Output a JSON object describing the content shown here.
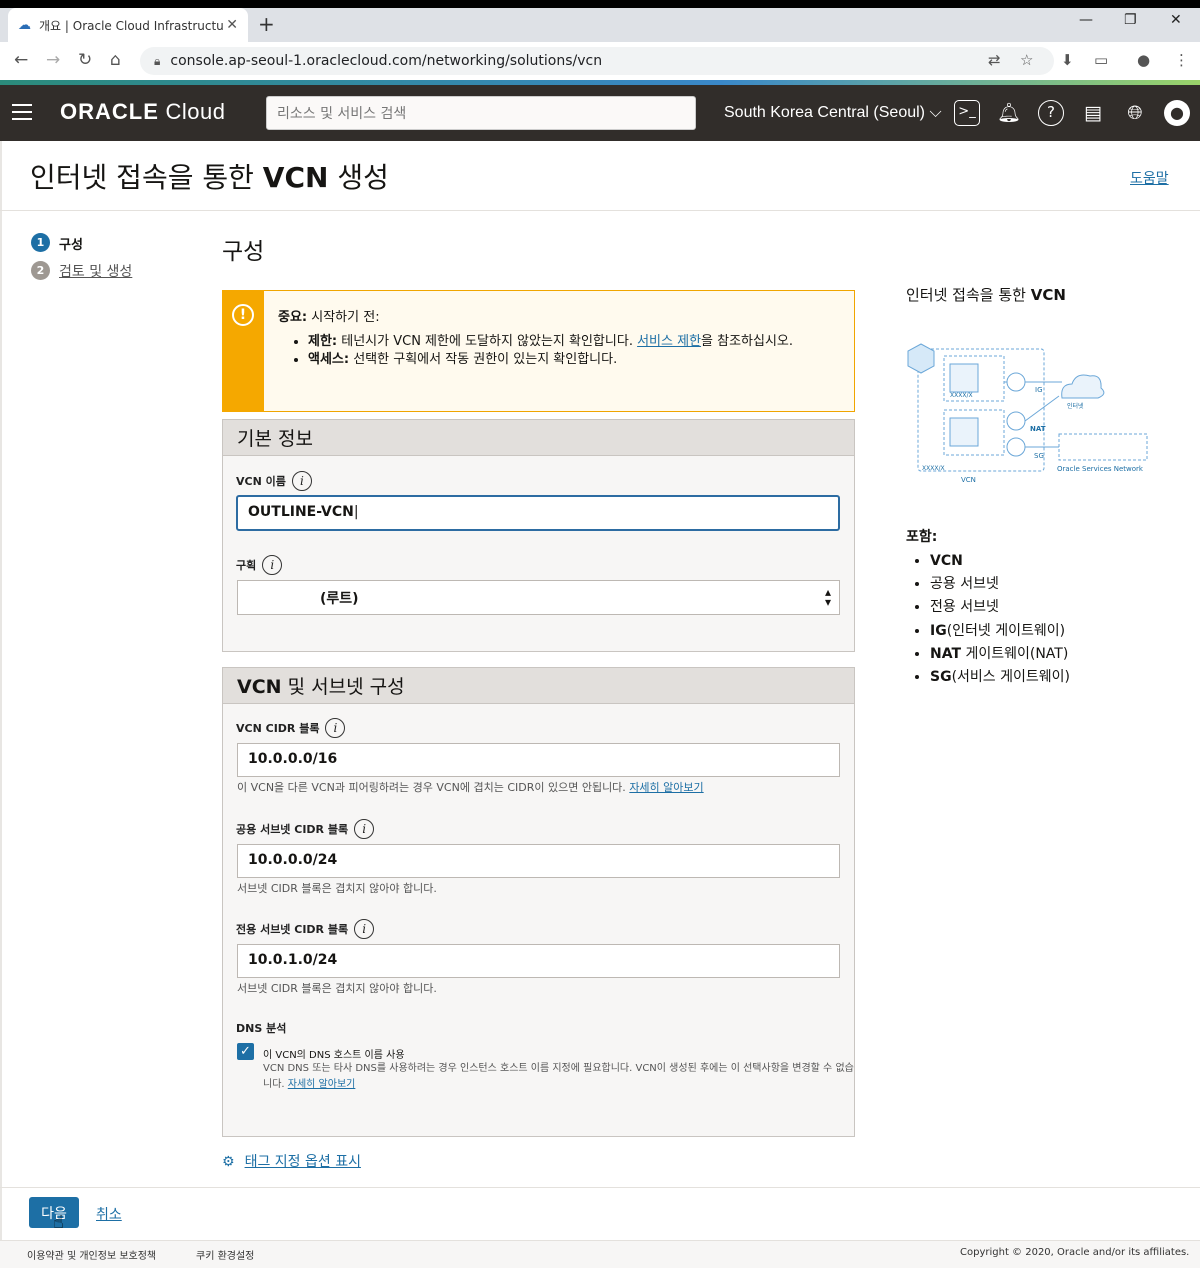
{
  "browser": {
    "tab_title": "개요 | Oracle Cloud Infrastructu",
    "url": "console.ap-seoul-1.oraclecloud.com/networking/solutions/vcn"
  },
  "header": {
    "logo_bold": "ORACLE",
    "logo_rest": " Cloud",
    "search_placeholder": "리소스 및 서비스 검색",
    "region": "South Korea Central (Seoul)"
  },
  "page": {
    "title_pre": "인터넷 접속을 통한 ",
    "title_bold": "VCN",
    "title_post": " 생성",
    "help": "도움말"
  },
  "steps": [
    {
      "num": "1",
      "label": "구성"
    },
    {
      "num": "2",
      "label": "검토 및 생성"
    }
  ],
  "section_title": "구성",
  "warning": {
    "head_bold": "중요:",
    "head_text": " 시작하기 전:",
    "item1_bold": "제한:",
    "item1_text": " 테넌시가 VCN 제한에 도달하지 않았는지 확인합니다. ",
    "item1_link": "서비스 제한",
    "item1_tail": "을 참조하십시오.",
    "item2_bold": "액세스:",
    "item2_text": " 선택한 구획에서 작동 권한이 있는지 확인합니다."
  },
  "basic": {
    "title": "기본 정보",
    "vcn_name_label": "VCN 이름",
    "vcn_name_value": "OUTLINE-VCN",
    "compartment_label": "구획",
    "compartment_value": "(루트)"
  },
  "config": {
    "title_bold": "VCN",
    "title_rest": " 및 서브넷 구성",
    "vcn_cidr_label": "VCN CIDR 블록",
    "vcn_cidr_value": "10.0.0.0/16",
    "vcn_cidr_hint": "이 VCN을 다른 VCN과 피어링하려는 경우 VCN에 겹치는 CIDR이 있으면 안됩니다. ",
    "learn_more": "자세히 알아보기",
    "public_label": "공용 서브넷 CIDR 블록",
    "public_value": "10.0.0.0/24",
    "public_hint": "서브넷 CIDR 블록은 겹치지 않아야 합니다.",
    "private_label": "전용 서브넷 CIDR 블록",
    "private_value": "10.0.1.0/24",
    "private_hint": "서브넷 CIDR 블록은 겹치지 않아야 합니다.",
    "dns_label": "DNS 분석",
    "dns_check_label": "이 VCN의 DNS 호스트 이름 사용",
    "dns_desc": "VCN DNS 또는 타사 DNS를 사용하려는 경우 인스턴스 호스트 이름 지정에 필요합니다. VCN이 생성된 후에는 이 선택사항을 변경할 수 없습니다. ",
    "dns_learn_more": "자세히 알아보기"
  },
  "right": {
    "title_pre": "인터넷 접속을 통한 ",
    "title_bold": "VCN",
    "diagram": {
      "ig": "IG",
      "nat": "NAT",
      "sg": "SG",
      "internet": "인터넷",
      "oracle_services": "Oracle Services Network",
      "vcn": "VCN",
      "subnet_cidr": "XXXX/X",
      "vcn_cidr": "XXXX/X"
    },
    "includes": "포함:",
    "items": [
      {
        "bold": "VCN",
        "text": ""
      },
      {
        "bold": "",
        "text": "공용 서브넷"
      },
      {
        "bold": "",
        "text": "전용 서브넷"
      },
      {
        "bold": "IG",
        "text": "(인터넷 게이트웨이)"
      },
      {
        "bold": "NAT",
        "text": " 게이트웨이(NAT)"
      },
      {
        "bold": "SG",
        "text": "(서비스 게이트웨이)"
      }
    ]
  },
  "footer": {
    "tag_options": "태그 지정 옵션 표시",
    "next": "다음",
    "cancel": "취소",
    "terms": "이용약관 및 개인정보 보호정책",
    "cookies": "쿠키 환경설정",
    "copyright": "Copyright © 2020, Oracle and/or its affiliates."
  }
}
